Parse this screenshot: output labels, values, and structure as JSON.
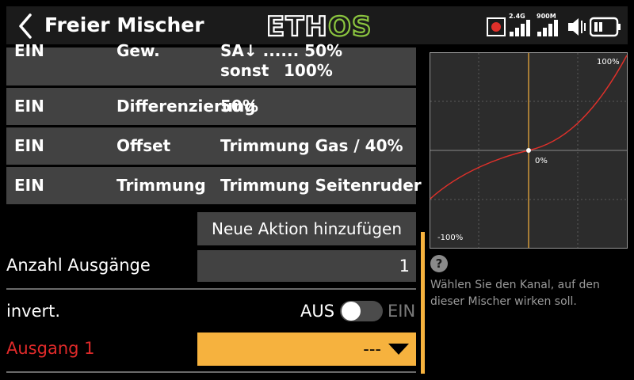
{
  "header": {
    "title": "Freier Mischer",
    "logo_text": "ETHOS",
    "signal": {
      "band1": "2.4G",
      "band2": "900M"
    }
  },
  "actions": {
    "partial_row": {
      "col1": "EIN",
      "col2": "Gew.",
      "col3": "SA↓ ...... 50%"
    },
    "partial_row_2": {
      "col3_label": "sonst",
      "col3_value": "100%"
    },
    "rows": [
      {
        "col1": "EIN",
        "col2": "Differenzierung",
        "col3": "50%"
      },
      {
        "col1": "EIN",
        "col2": "Offset",
        "col3": "Trimmung Gas / 40%"
      },
      {
        "col1": "EIN",
        "col2": "Trimmung",
        "col3": "Trimmung Seitenruder"
      }
    ],
    "add_label": "Neue Aktion hinzufügen"
  },
  "outputs": {
    "label": "Anzahl Ausgänge",
    "value": "1"
  },
  "invert": {
    "label": "invert.",
    "off_label": "AUS",
    "on_label": "EIN",
    "state": "off"
  },
  "output1": {
    "label": "Ausgang 1",
    "value": "---"
  },
  "curve": {
    "max_label": "100%",
    "center_label": "0%",
    "min_label": "-100%"
  },
  "help": {
    "icon": "?",
    "text": "Wählen Sie den Kanal, auf den dieser Mischer wirken soll."
  },
  "colors": {
    "accent": "#f6b23e",
    "curve": "#e0302a",
    "warning": "#e02a2a",
    "logo_green": "#8bc53f"
  }
}
